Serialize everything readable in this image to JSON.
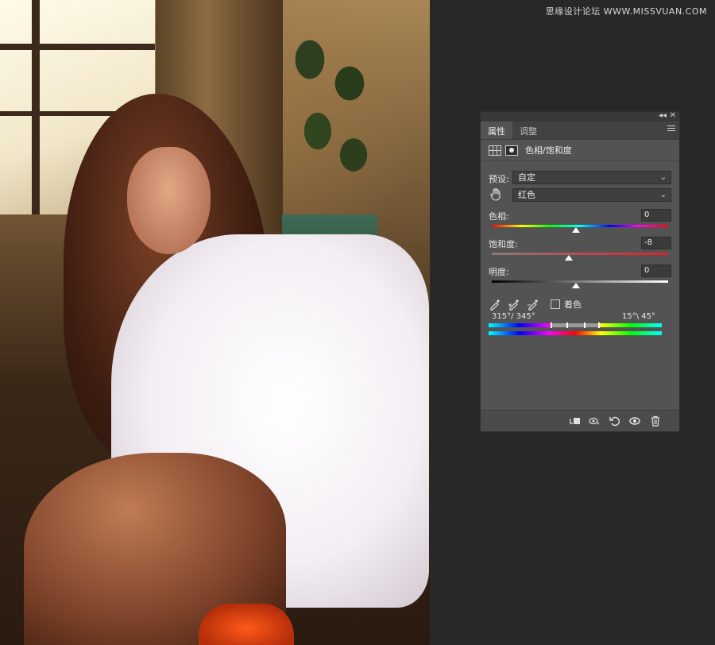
{
  "watermark": "思缘设计论坛 WWW.MISSVUAN.COM",
  "panel": {
    "tabs": [
      {
        "label": "属性",
        "active": true
      },
      {
        "label": "调整",
        "active": false
      }
    ],
    "collapse_glyph": "◂◂",
    "close_glyph": "✕",
    "title": "色相/饱和度",
    "preset": {
      "label": "预设:",
      "value": "自定"
    },
    "channel": {
      "value": "红色"
    },
    "hue": {
      "label": "色相:",
      "value": "0"
    },
    "saturation": {
      "label": "饱和度:",
      "value": "-8"
    },
    "lightness": {
      "label": "明度:",
      "value": "0"
    },
    "colorize": {
      "label": "着色",
      "checked": false
    },
    "range": {
      "left": "315°/ 345°",
      "right": "15°\\ 45°"
    },
    "icons": {
      "sample": "eyedropper-icon",
      "add": "eyedropper-plus-icon",
      "subtract": "eyedropper-minus-icon",
      "clip": "clip-to-layer-icon",
      "view_previous": "view-previous-icon",
      "reset": "reset-icon",
      "visibility": "eye-icon",
      "delete": "trash-icon"
    },
    "colors": {
      "panel_bg": "#535353",
      "saturation_track_start": "#8a7a7a",
      "saturation_track_end": "#e0202a"
    }
  }
}
